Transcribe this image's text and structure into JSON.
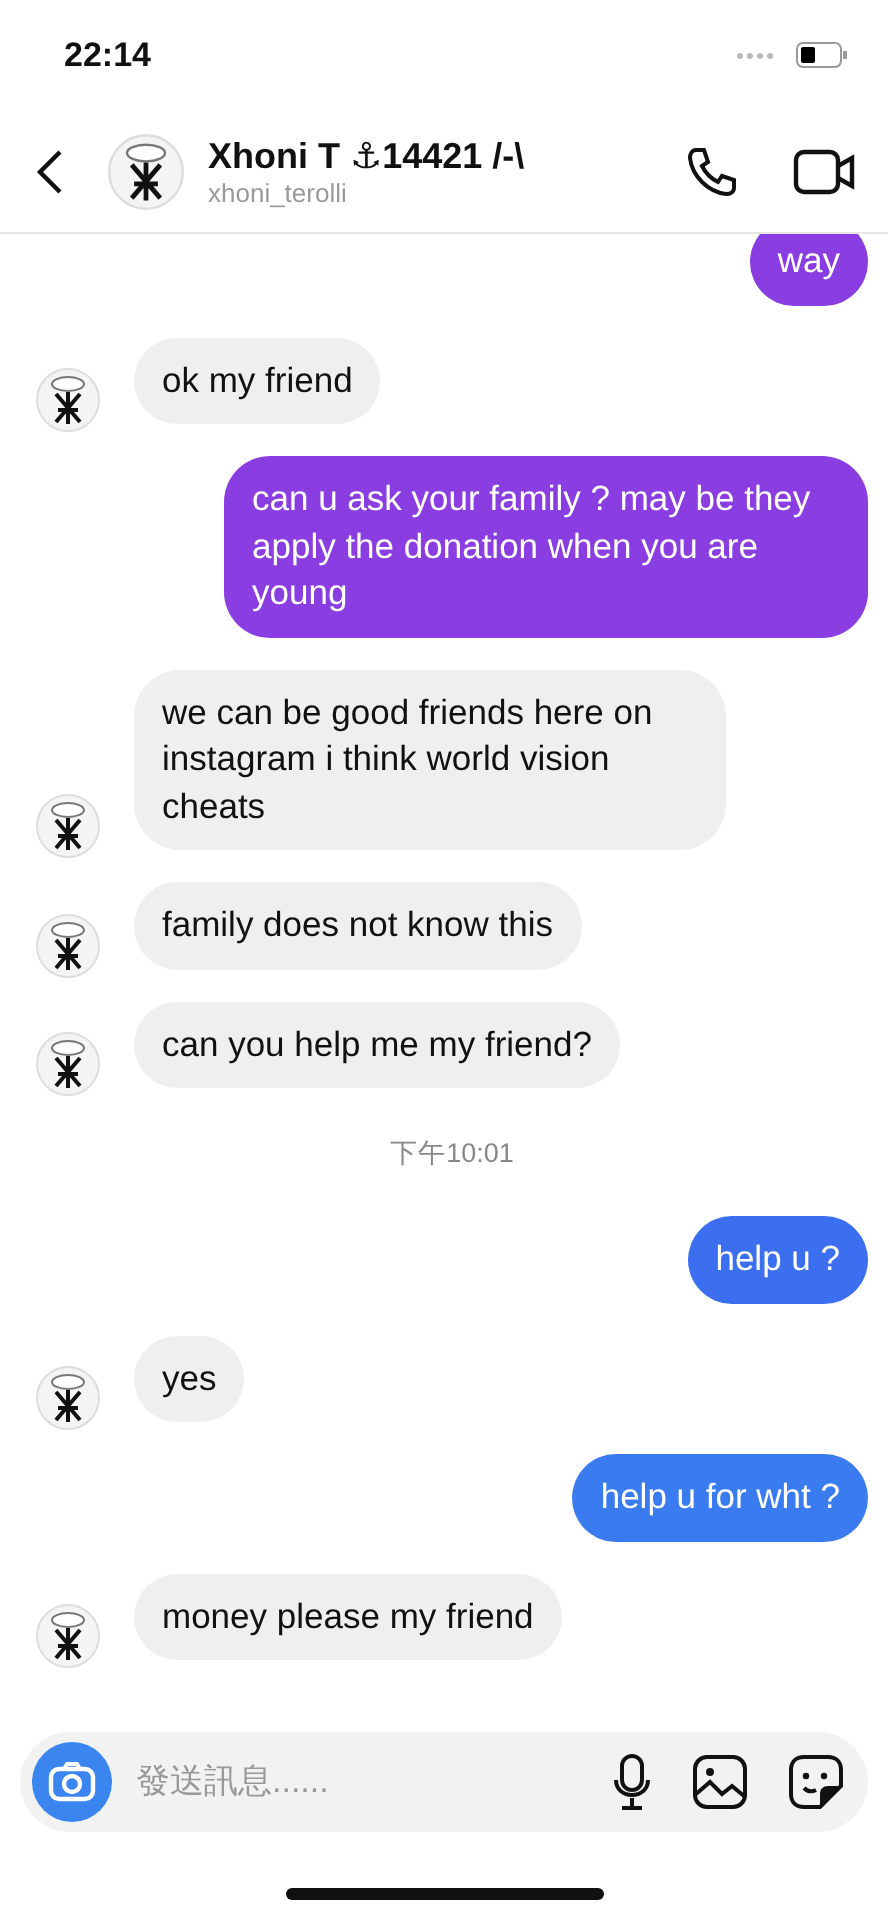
{
  "status_bar": {
    "time": "22:14"
  },
  "header": {
    "name": "Xhoni T ⚓14421 /-\\",
    "username": "xhoni_terolli"
  },
  "messages": [
    {
      "kind": "outgoing",
      "text": "way",
      "color": "#8a3de0"
    },
    {
      "kind": "incoming",
      "text": "ok my friend"
    },
    {
      "kind": "outgoing",
      "text": "can u ask your family ? may be they apply the donation when you are young",
      "color": "#8a3de0"
    },
    {
      "kind": "incoming",
      "text": "we can be good friends here on instagram i think world vision cheats"
    },
    {
      "kind": "incoming",
      "text": "family does not know this"
    },
    {
      "kind": "incoming",
      "text": "can you help me my friend?"
    },
    {
      "kind": "time",
      "text": "下午10:01"
    },
    {
      "kind": "outgoing",
      "text": "help u ?",
      "color": "#3b6ff0"
    },
    {
      "kind": "incoming",
      "text": "yes"
    },
    {
      "kind": "outgoing",
      "text": "help u for wht ?",
      "color": "#3a7cf0"
    },
    {
      "kind": "incoming",
      "text": "money please my friend"
    }
  ],
  "composer": {
    "placeholder": "發送訊息......"
  }
}
